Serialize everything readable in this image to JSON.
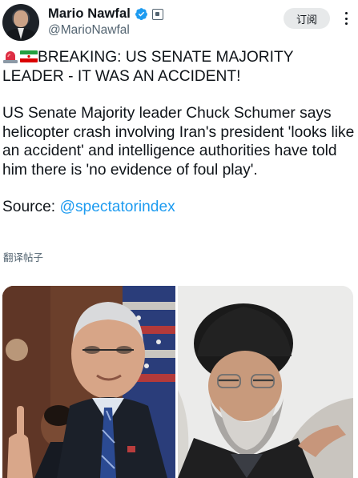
{
  "author": {
    "display_name": "Mario Nawfal",
    "handle": "@MarioNawfal",
    "verified": true
  },
  "header": {
    "follow_label": "订阅"
  },
  "tweet": {
    "headline": "BREAKING: US SENATE MAJORITY LEADER - IT WAS AN ACCIDENT!",
    "headline_emoji": [
      "siren-emoji",
      "iran-flag-emoji"
    ],
    "body": "US Senate Majority leader Chuck Schumer says helicopter crash involving Iran's president 'looks like an accident' and intelligence authorities have told him there is 'no evidence of foul play'.",
    "source_prefix": "Source: ",
    "source_link": "@spectatorindex",
    "translate_label": "翻译帖子"
  },
  "media": {
    "images": [
      "chuck-schumer-photo",
      "iran-president-photo"
    ]
  },
  "colors": {
    "link": "#1d9bf0",
    "verified": "#1d9bf0",
    "text": "#0f1419",
    "secondary": "#536471",
    "button_bg": "#e7e9ea"
  }
}
